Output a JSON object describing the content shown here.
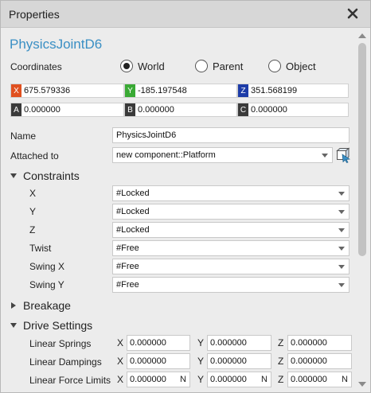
{
  "window": {
    "title": "Properties"
  },
  "object": {
    "name": "PhysicsJointD6"
  },
  "coordinates": {
    "label": "Coordinates",
    "options": [
      "World",
      "Parent",
      "Object"
    ],
    "selected": "World",
    "x": "675.579336",
    "y": "-185.197548",
    "z": "351.568199",
    "a": "0.000000",
    "b": "0.000000",
    "c": "0.000000",
    "tags": {
      "x": "X",
      "y": "Y",
      "z": "Z",
      "a": "A",
      "b": "B",
      "c": "C"
    },
    "colors": {
      "x": "#e0501f",
      "y": "#3aaa35",
      "z": "#1d3ca8",
      "a": "#3a3a3a",
      "b": "#3a3a3a",
      "c": "#3a3a3a"
    }
  },
  "props": {
    "name_label": "Name",
    "name_value": "PhysicsJointD6",
    "attached_label": "Attached to",
    "attached_value": "new component::Platform"
  },
  "constraints": {
    "title": "Constraints",
    "rows": [
      {
        "label": "X",
        "value": "#Locked"
      },
      {
        "label": "Y",
        "value": "#Locked"
      },
      {
        "label": "Z",
        "value": "#Locked"
      },
      {
        "label": "Twist",
        "value": "#Free"
      },
      {
        "label": "Swing X",
        "value": "#Free"
      },
      {
        "label": "Swing Y",
        "value": "#Free"
      }
    ]
  },
  "breakage": {
    "title": "Breakage"
  },
  "drive": {
    "title": "Drive Settings",
    "axis_labels": [
      "X",
      "Y",
      "Z"
    ],
    "rows": [
      {
        "label": "Linear Springs",
        "x": "0.000000",
        "y": "0.000000",
        "z": "0.000000",
        "unit": ""
      },
      {
        "label": "Linear Dampings",
        "x": "0.000000",
        "y": "0.000000",
        "z": "0.000000",
        "unit": ""
      },
      {
        "label": "Linear Force Limits",
        "x": "0.000000",
        "y": "0.000000",
        "z": "0.000000",
        "unit": "N"
      }
    ]
  },
  "icons": {
    "close": "close-icon",
    "pick": "pick-object-icon"
  },
  "accent": "#3a8fc4"
}
